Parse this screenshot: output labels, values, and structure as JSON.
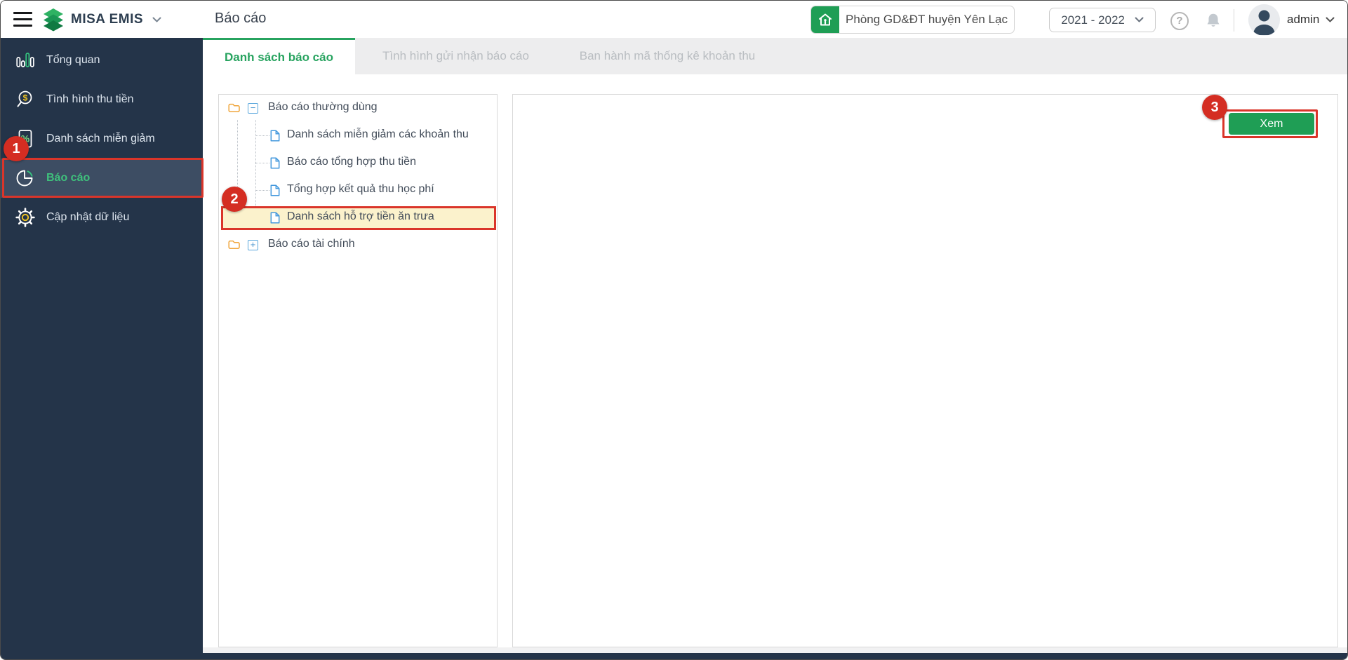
{
  "header": {
    "brand": "MISA EMIS",
    "page_title": "Báo cáo",
    "org_button_label": "Phòng GD&ĐT huyện Yên Lạc",
    "year_selected": "2021 - 2022",
    "help_glyph": "?",
    "username": "admin"
  },
  "sidebar": {
    "items": [
      {
        "label": "Tổng quan",
        "icon": "bar-chart-icon",
        "active": false
      },
      {
        "label": "Tình hình thu tiền",
        "icon": "search-money-icon",
        "active": false
      },
      {
        "label": "Danh sách miễn giảm",
        "icon": "percent-document-icon",
        "active": false
      },
      {
        "label": "Báo cáo",
        "icon": "pie-chart-icon",
        "active": true
      },
      {
        "label": "Cập nhật dữ liệu",
        "icon": "gear-icon",
        "active": false
      }
    ]
  },
  "tabs": [
    {
      "label": "Danh sách báo cáo",
      "active": true
    },
    {
      "label": "Tình hình gửi nhận báo cáo",
      "active": false
    },
    {
      "label": "Ban hành mã thống kê khoản thu",
      "active": false
    }
  ],
  "tree": {
    "root1": "Báo cáo thường dùng",
    "collapse_glyph": "−",
    "expand_glyph": "+",
    "children": [
      "Danh sách miễn giảm các khoản thu",
      "Báo cáo tổng hợp thu tiền",
      "Tổng hợp kết quả thu học phí",
      "Danh sách hỗ trợ tiền ăn trưa"
    ],
    "selected_child_index": 3,
    "root2": "Báo cáo tài chính"
  },
  "actions": {
    "view_button": "Xem"
  },
  "annotations": {
    "steps": [
      "1",
      "2",
      "3"
    ]
  },
  "colors": {
    "brand_green": "#1f9e55",
    "tab_active_green": "#27a35f",
    "sidebar_bg": "#243449",
    "sidebar_active_bg": "#3d4d63",
    "sidebar_active_text": "#3fc07c",
    "annotation_red": "#da352a",
    "badge_red": "#d42d22",
    "highlight_yellow": "#fbf2cc",
    "tree_icon_blue": "#4398dd",
    "folder_orange": "#f0a63c"
  }
}
